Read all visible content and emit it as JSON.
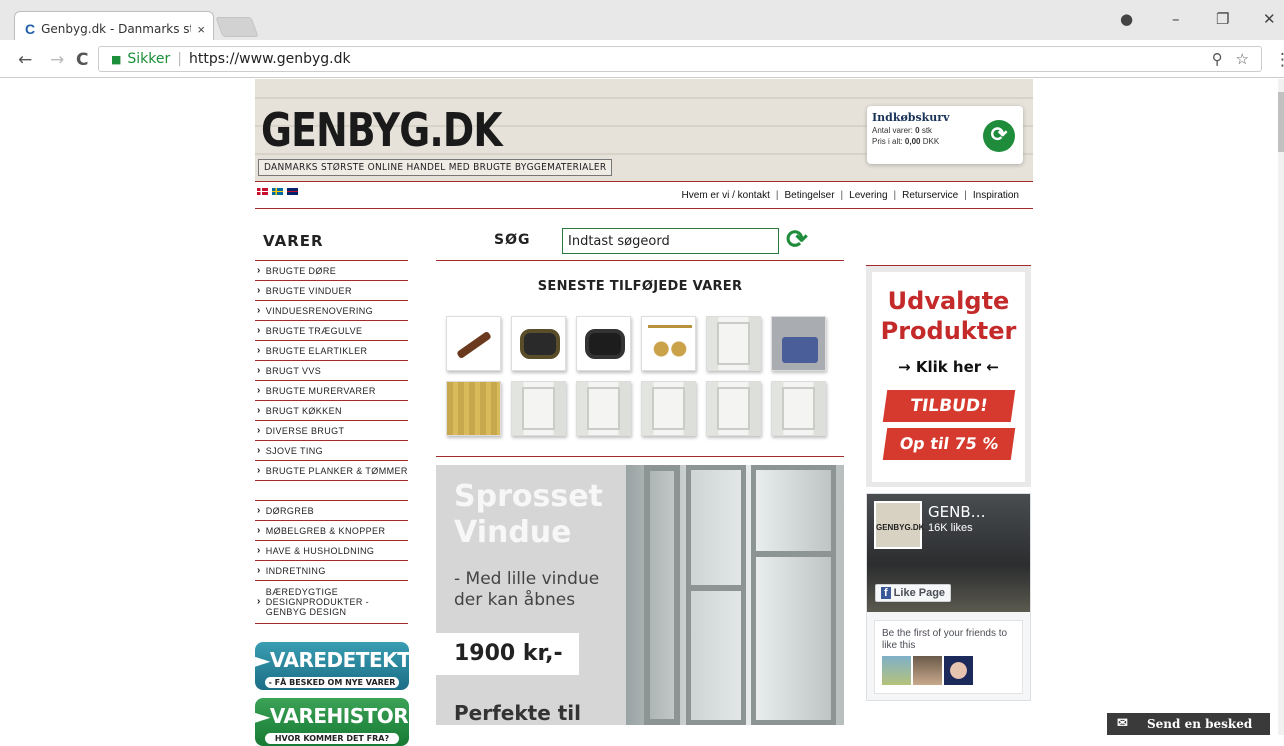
{
  "browser": {
    "tab_title": "Genbyg.dk - Danmarks st",
    "tab_close": "×",
    "secure_label": "Sikker",
    "url": "https://www.genbyg.dk",
    "back_icon": "←",
    "forward_icon": "→",
    "reload_icon": "C",
    "zoom_icon": "⚲",
    "star_icon": "☆",
    "menu_icon": "⋮",
    "profile_icon": "●",
    "minimize": "–",
    "restore": "❐",
    "close": "✕"
  },
  "header": {
    "logo": "GENBYG.DK",
    "tagline": "DANMARKS STØRSTE ONLINE HANDEL MED BRUGTE BYGGEMATERIALER",
    "cart_title": "Indkøbskurv",
    "cart_count_label": "Antal varer: ",
    "cart_count": "0",
    "cart_count_unit": " stk",
    "cart_price_label": "Pris i alt: ",
    "cart_price": "0,00",
    "cart_price_unit": " DKK"
  },
  "topnav": {
    "links": [
      "Hvem er vi / kontakt",
      "Betingelser",
      "Levering",
      "Returservice",
      "Inspiration"
    ]
  },
  "left": {
    "heading": "VARER",
    "categories": [
      "BRUGTE DØRE",
      "BRUGTE VINDUER",
      "VINDUESRENOVERING",
      "BRUGTE TRÆGULVE",
      "BRUGTE ELARTIKLER",
      "BRUGT VVS",
      "BRUGTE MURERVARER",
      "BRUGT KØKKEN",
      "DIVERSE BRUGT",
      "SJOVE TING",
      "BRUGTE PLANKER & TØMMER"
    ],
    "categories2": [
      "DØRGREB",
      "MØBELGREB & KNOPPER",
      "HAVE & HUSHOLDNING",
      "INDRETNING",
      "BÆREDYGTIGE DESIGNPRODUKTER - GENBYG DESIGN"
    ],
    "btn1": "►VAREDETEKTIV",
    "btn1_sub": "- FÅ BESKED OM NYE VARER",
    "btn2": "►VAREHISTORIER",
    "btn2_sub": "HVOR KOMMER DET FRA?"
  },
  "search": {
    "label": "SØG",
    "placeholder": "Indtast søgeord"
  },
  "latest": {
    "heading": "SENESTE TILFØJEDE VARER"
  },
  "promo": {
    "title1": "Sprosset",
    "title2": "Vindue",
    "sub1": "- Med lille vindue",
    "sub2": "der kan åbnes",
    "price": "1900 kr,-",
    "more": "Perfekte til"
  },
  "right": {
    "udv1": "Udvalgte",
    "udv2": "Produkter",
    "klik": "→ Klik her ←",
    "tilbud": "TILBUD!",
    "optil": "Op til 75 %"
  },
  "facebook": {
    "name": "GENB…",
    "likes": "16K likes",
    "thumb_text": "GENBYG.DK",
    "like_button": "Like Page",
    "friends": "Be the first of your friends to like this"
  },
  "chat": {
    "label": "Send en besked"
  },
  "colors": {
    "accent_red": "#a52a2a",
    "brand_green": "#1f8c3b"
  }
}
